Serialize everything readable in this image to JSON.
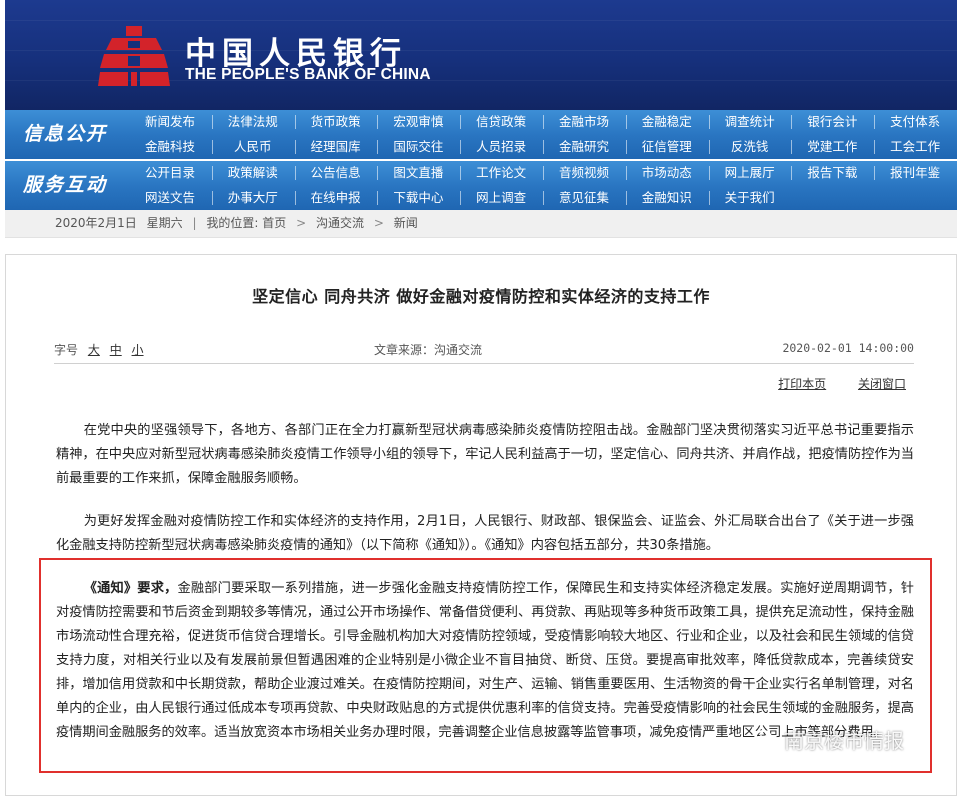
{
  "header": {
    "name_cn": "中国人民银行",
    "name_en": "THE PEOPLE'S BANK OF CHINA",
    "colors": {
      "banner": "#16307c",
      "logo_red": "#d3232a"
    }
  },
  "nav": {
    "info_title": "信息公开",
    "service_title": "服务互动",
    "info_rows": [
      [
        "新闻发布",
        "法律法规",
        "货币政策",
        "宏观审慎",
        "信贷政策",
        "金融市场",
        "金融稳定",
        "调查统计",
        "银行会计",
        "支付体系"
      ],
      [
        "金融科技",
        "人民币",
        "经理国库",
        "国际交往",
        "人员招录",
        "金融研究",
        "征信管理",
        "反洗钱",
        "党建工作",
        "工会工作"
      ]
    ],
    "service_rows": [
      [
        "公开目录",
        "政策解读",
        "公告信息",
        "图文直播",
        "工作论文",
        "音频视频",
        "市场动态",
        "网上展厅",
        "报告下载",
        "报刊年鉴"
      ],
      [
        "网送文告",
        "办事大厅",
        "在线申报",
        "下载中心",
        "网上调查",
        "意见征集",
        "金融知识",
        "关于我们"
      ]
    ]
  },
  "breadcrumb": {
    "date": "2020年2月1日",
    "weekday": "星期六",
    "location_label": "我的位置:",
    "items": [
      "首页",
      "沟通交流",
      "新闻"
    ],
    "sep": ">"
  },
  "article": {
    "title": "坚定信心 同舟共济 做好金融对疫情防控和实体经济的支持工作",
    "font_label": "字号",
    "font_sizes": [
      "大",
      "中",
      "小"
    ],
    "source": "文章来源：沟通交流",
    "datetime": "2020-02-01 14:00:00",
    "print_label": "打印本页",
    "close_label": "关闭窗口",
    "p1": "在党中央的坚强领导下，各地方、各部门正在全力打赢新型冠状病毒感染肺炎疫情防控阻击战。金融部门坚决贯彻落实习近平总书记重要指示精神，在中央应对新型冠状病毒感染肺炎疫情工作领导小组的领导下，牢记人民利益高于一切，坚定信心、同舟共济、并肩作战，把疫情防控作为当前最重要的工作来抓，保障金融服务顺畅。",
    "p2": "为更好发挥金融对疫情防控工作和实体经济的支持作用，2月1日，人民银行、财政部、银保监会、证监会、外汇局联合出台了《关于进一步强化金融支持防控新型冠状病毒感染肺炎疫情的通知》（以下简称《通知》）。《通知》内容包括五部分，共30条措施。",
    "p3_lead": "《通知》要求，",
    "p3": "金融部门要采取一系列措施，进一步强化金融支持疫情防控工作，保障民生和支持实体经济稳定发展。实施好逆周期调节，针对疫情防控需要和节后资金到期较多等情况，通过公开市场操作、常备借贷便利、再贷款、再贴现等多种货币政策工具，提供充足流动性，保持金融市场流动性合理充裕，促进货币信贷合理增长。引导金融机构加大对疫情防控领域，受疫情影响较大地区、行业和企业，以及社会和民生领域的信贷支持力度，对相关行业以及有发展前景但暂遇困难的企业特别是小微企业不盲目抽贷、断贷、压贷。要提高审批效率，降低贷款成本，完善续贷安排，增加信用贷款和中长期贷款，帮助企业渡过难关。在疫情防控期间，对生产、运输、销售重要医用、生活物资的骨干企业实行名单制管理，对名单内的企业，由人民银行通过低成本专项再贷款、中央财政贴息的方式提供优惠利率的信贷支持。完善受疫情影响的社会民生领域的金融服务，提高疫情期间金融服务的效率。适当放宽资本市场相关业务办理时限，完善调整企业信息披露等监管事项，减免疫情严重地区公司上市等部分费用。"
  },
  "watermark": {
    "text": "南京楼市情报",
    "icon": "wechat-icon"
  },
  "highlight_color": "#e0302d"
}
